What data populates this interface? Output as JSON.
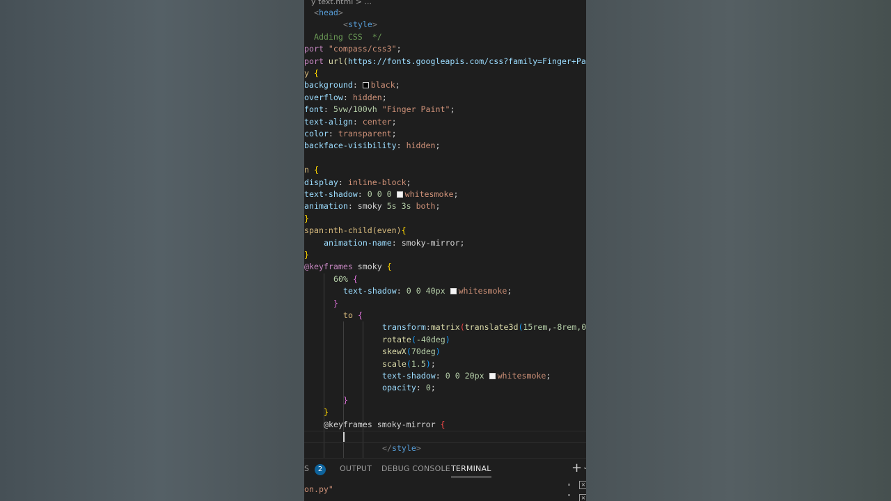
{
  "breadcrumb": {
    "text": "y text.html > ..."
  },
  "code_lines": [
    {
      "indent": 14,
      "tokens": [
        {
          "t": "<",
          "c": "t-br"
        },
        {
          "t": "head",
          "c": "t-tag"
        },
        {
          "t": ">",
          "c": "t-br"
        }
      ]
    },
    {
      "indent": 56,
      "tokens": [
        {
          "t": "<",
          "c": "t-br"
        },
        {
          "t": "style",
          "c": "t-tag"
        },
        {
          "t": ">",
          "c": "t-br"
        }
      ]
    },
    {
      "indent": 0,
      "tokens": [
        {
          "t": "  Adding CSS  */",
          "c": "t-com"
        }
      ]
    },
    {
      "indent": 0,
      "tokens": [
        {
          "t": "port ",
          "c": "t-kw"
        },
        {
          "t": "\"compass/css3\"",
          "c": "t-str"
        },
        {
          "t": ";",
          "c": ""
        }
      ]
    },
    {
      "indent": 0,
      "tokens": [
        {
          "t": "port ",
          "c": "t-kw"
        },
        {
          "t": "url(",
          "c": "t-fn"
        },
        {
          "t": "https://fonts.googleapis.com/css?family=Finger+Pai",
          "c": "t-url"
        }
      ]
    },
    {
      "indent": 0,
      "tokens": [
        {
          "t": "y ",
          "c": "t-sel"
        },
        {
          "t": "{",
          "c": "t-b1"
        }
      ]
    },
    {
      "indent": 0,
      "tokens": [
        {
          "t": "background",
          "c": "t-prop"
        },
        {
          "t": ": ",
          "c": ""
        },
        {
          "swatch": "#000000"
        },
        {
          "t": "black",
          "c": "t-str"
        },
        {
          "t": ";",
          "c": ""
        }
      ]
    },
    {
      "indent": 0,
      "tokens": [
        {
          "t": "overflow",
          "c": "t-prop"
        },
        {
          "t": ": ",
          "c": ""
        },
        {
          "t": "hidden",
          "c": "t-str"
        },
        {
          "t": ";",
          "c": ""
        }
      ]
    },
    {
      "indent": 0,
      "tokens": [
        {
          "t": "font",
          "c": "t-prop"
        },
        {
          "t": ": ",
          "c": ""
        },
        {
          "t": "5vw",
          "c": "t-num"
        },
        {
          "t": "/",
          "c": ""
        },
        {
          "t": "100vh",
          "c": "t-num"
        },
        {
          "t": " ",
          "c": ""
        },
        {
          "t": "\"Finger Paint\"",
          "c": "t-str"
        },
        {
          "t": ";",
          "c": ""
        }
      ]
    },
    {
      "indent": 0,
      "tokens": [
        {
          "t": "text-align",
          "c": "t-prop"
        },
        {
          "t": ": ",
          "c": ""
        },
        {
          "t": "center",
          "c": "t-str"
        },
        {
          "t": ";",
          "c": ""
        }
      ]
    },
    {
      "indent": 0,
      "tokens": [
        {
          "t": "color",
          "c": "t-prop"
        },
        {
          "t": ": ",
          "c": ""
        },
        {
          "t": "transparent",
          "c": "t-str"
        },
        {
          "t": ";",
          "c": ""
        }
      ]
    },
    {
      "indent": 0,
      "tokens": [
        {
          "t": "backface-visibility",
          "c": "t-prop"
        },
        {
          "t": ": ",
          "c": ""
        },
        {
          "t": "hidden",
          "c": "t-str"
        },
        {
          "t": ";",
          "c": ""
        }
      ]
    },
    {
      "indent": 0,
      "tokens": []
    },
    {
      "indent": 0,
      "tokens": [
        {
          "t": "n ",
          "c": "t-sel"
        },
        {
          "t": "{",
          "c": "t-b1"
        }
      ]
    },
    {
      "indent": 0,
      "tokens": [
        {
          "t": "display",
          "c": "t-prop"
        },
        {
          "t": ": ",
          "c": ""
        },
        {
          "t": "inline-block",
          "c": "t-str"
        },
        {
          "t": ";",
          "c": ""
        }
      ]
    },
    {
      "indent": 0,
      "tokens": [
        {
          "t": "text-shadow",
          "c": "t-prop"
        },
        {
          "t": ": ",
          "c": ""
        },
        {
          "t": "0 0 0 ",
          "c": "t-num"
        },
        {
          "swatch": "#f5f5f5"
        },
        {
          "t": "whitesmoke",
          "c": "t-str"
        },
        {
          "t": ";",
          "c": ""
        }
      ]
    },
    {
      "indent": 0,
      "tokens": [
        {
          "t": "animation",
          "c": "t-prop"
        },
        {
          "t": ": ",
          "c": ""
        },
        {
          "t": "smoky ",
          "c": ""
        },
        {
          "t": "5s 3s",
          "c": "t-num"
        },
        {
          "t": " ",
          "c": ""
        },
        {
          "t": "both",
          "c": "t-str"
        },
        {
          "t": ";",
          "c": ""
        }
      ]
    },
    {
      "indent": 0,
      "tokens": [
        {
          "t": "}",
          "c": "t-b1"
        }
      ]
    },
    {
      "indent": 0,
      "tokens": [
        {
          "t": "span:nth-child(even)",
          "c": "t-sel"
        },
        {
          "t": "{",
          "c": "t-b1"
        }
      ]
    },
    {
      "indent": 28,
      "tokens": [
        {
          "t": "animation-name",
          "c": "t-prop"
        },
        {
          "t": ": ",
          "c": ""
        },
        {
          "t": "smoky-mirror",
          "c": ""
        },
        {
          "t": ";",
          "c": ""
        }
      ]
    },
    {
      "indent": 0,
      "tokens": [
        {
          "t": "}",
          "c": "t-b1"
        }
      ]
    },
    {
      "indent": 0,
      "tokens": [
        {
          "t": "@keyframes",
          "c": "t-kw"
        },
        {
          "t": " smoky ",
          "c": ""
        },
        {
          "t": "{",
          "c": "t-b1"
        }
      ]
    },
    {
      "indent": 42,
      "tokens": [
        {
          "t": "60%",
          "c": "t-num"
        },
        {
          "t": " ",
          "c": ""
        },
        {
          "t": "{",
          "c": "t-b2"
        }
      ]
    },
    {
      "indent": 56,
      "tokens": [
        {
          "t": "text-shadow",
          "c": "t-prop"
        },
        {
          "t": ": ",
          "c": ""
        },
        {
          "t": "0 0 40px ",
          "c": "t-num"
        },
        {
          "swatch": "#f5f5f5"
        },
        {
          "t": "whitesmoke",
          "c": "t-str"
        },
        {
          "t": ";",
          "c": ""
        }
      ]
    },
    {
      "indent": 42,
      "tokens": [
        {
          "t": "}",
          "c": "t-b2"
        }
      ]
    },
    {
      "indent": 56,
      "tokens": [
        {
          "t": "to ",
          "c": "t-sel"
        },
        {
          "t": "{",
          "c": "t-b2"
        }
      ]
    },
    {
      "indent": 112,
      "tokens": [
        {
          "t": "transform",
          "c": "t-prop"
        },
        {
          "t": ":",
          "c": ""
        },
        {
          "t": "matrix",
          "c": "t-fn"
        },
        {
          "t": "(",
          "c": "t-err"
        },
        {
          "t": "translate3d",
          "c": "t-fn"
        },
        {
          "t": "(",
          "c": "t-b3"
        },
        {
          "t": "15rem",
          "c": "t-num"
        },
        {
          "t": ",",
          "c": ""
        },
        {
          "t": "-8rem",
          "c": "t-num"
        },
        {
          "t": ",0",
          "c": "t-num"
        }
      ]
    },
    {
      "indent": 112,
      "tokens": [
        {
          "t": "rotate",
          "c": "t-fn"
        },
        {
          "t": "(",
          "c": "t-b3"
        },
        {
          "t": "-40deg",
          "c": "t-num"
        },
        {
          "t": ")",
          "c": "t-b3"
        }
      ]
    },
    {
      "indent": 112,
      "tokens": [
        {
          "t": "skewX",
          "c": "t-fn"
        },
        {
          "t": "(",
          "c": "t-b3"
        },
        {
          "t": "70deg",
          "c": "t-num"
        },
        {
          "t": ")",
          "c": "t-b3"
        }
      ]
    },
    {
      "indent": 112,
      "tokens": [
        {
          "t": "scale",
          "c": "t-fn"
        },
        {
          "t": "(",
          "c": "t-b3"
        },
        {
          "t": "1.5",
          "c": "t-num"
        },
        {
          "t": ")",
          "c": "t-b3"
        },
        {
          "t": ";",
          "c": ""
        }
      ]
    },
    {
      "indent": 112,
      "tokens": [
        {
          "t": "text-shadow",
          "c": "t-prop"
        },
        {
          "t": ": ",
          "c": ""
        },
        {
          "t": "0 0 20px ",
          "c": "t-num"
        },
        {
          "swatch": "#f5f5f5"
        },
        {
          "t": "whitesmoke",
          "c": "t-str"
        },
        {
          "t": ";",
          "c": ""
        }
      ]
    },
    {
      "indent": 112,
      "tokens": [
        {
          "t": "opacity",
          "c": "t-prop"
        },
        {
          "t": ": ",
          "c": ""
        },
        {
          "t": "0",
          "c": "t-num"
        },
        {
          "t": ";",
          "c": ""
        }
      ]
    },
    {
      "indent": 56,
      "tokens": [
        {
          "t": "}",
          "c": "t-b2"
        }
      ]
    },
    {
      "indent": 28,
      "tokens": [
        {
          "t": "}",
          "c": "t-b1"
        }
      ]
    },
    {
      "indent": 28,
      "tokens": [
        {
          "t": "@keyframes",
          "c": ""
        },
        {
          "t": " smoky-mirror ",
          "c": ""
        },
        {
          "t": "{",
          "c": "t-err"
        }
      ]
    },
    {
      "indent": 56,
      "tokens": [
        {
          "cursor": true
        }
      ],
      "active": true
    },
    {
      "indent": 112,
      "tokens": [
        {
          "t": "</",
          "c": "t-br"
        },
        {
          "t": "style",
          "c": "t-tag"
        },
        {
          "t": ">",
          "c": "t-br"
        }
      ]
    }
  ],
  "panel": {
    "tab_problems_suffix": "S",
    "problems_count": "2",
    "tab_output": "OUTPUT",
    "tab_debug": "DEBUG CONSOLE",
    "tab_terminal": "TERMINAL",
    "plus_symbol": "+",
    "chevron_symbol": "⌄",
    "terminal_text": "on.py\""
  }
}
